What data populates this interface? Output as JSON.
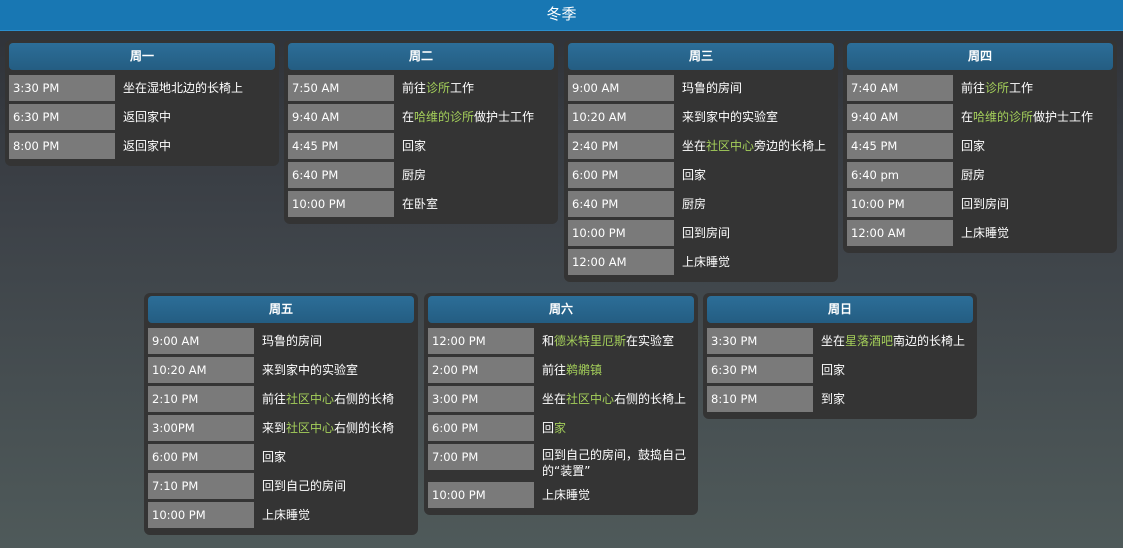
{
  "header": {
    "title": "冬季"
  },
  "days": [
    {
      "title": "周一",
      "entries": [
        {
          "time": "3:30 PM",
          "parts": [
            {
              "text": "坐在湿地北边的长椅上",
              "hl": false
            }
          ]
        },
        {
          "time": "6:30 PM",
          "parts": [
            {
              "text": "返回家中",
              "hl": false
            }
          ]
        },
        {
          "time": "8:00 PM",
          "parts": [
            {
              "text": "返回家中",
              "hl": false
            }
          ]
        }
      ]
    },
    {
      "title": "周二",
      "entries": [
        {
          "time": "7:50 AM",
          "parts": [
            {
              "text": "前往",
              "hl": false
            },
            {
              "text": "诊所",
              "hl": true
            },
            {
              "text": "工作",
              "hl": false
            }
          ]
        },
        {
          "time": "9:40 AM",
          "parts": [
            {
              "text": "在",
              "hl": false
            },
            {
              "text": "哈维的诊所",
              "hl": true
            },
            {
              "text": "做护士工作",
              "hl": false
            }
          ]
        },
        {
          "time": "4:45 PM",
          "parts": [
            {
              "text": "回家",
              "hl": false
            }
          ]
        },
        {
          "time": "6:40 PM",
          "parts": [
            {
              "text": "厨房",
              "hl": false
            }
          ]
        },
        {
          "time": "10:00 PM",
          "parts": [
            {
              "text": "在卧室",
              "hl": false
            }
          ]
        }
      ]
    },
    {
      "title": "周三",
      "entries": [
        {
          "time": "9:00 AM",
          "parts": [
            {
              "text": "玛鲁的房间",
              "hl": false
            }
          ]
        },
        {
          "time": "10:20 AM",
          "parts": [
            {
              "text": "来到家中的实验室",
              "hl": false
            }
          ]
        },
        {
          "time": "2:40 PM",
          "parts": [
            {
              "text": "坐在",
              "hl": false
            },
            {
              "text": "社区中心",
              "hl": true
            },
            {
              "text": "旁边的长椅上",
              "hl": false
            }
          ]
        },
        {
          "time": "6:00 PM",
          "parts": [
            {
              "text": "回家",
              "hl": false
            }
          ]
        },
        {
          "time": "6:40 PM",
          "parts": [
            {
              "text": "厨房",
              "hl": false
            }
          ]
        },
        {
          "time": "10:00 PM",
          "parts": [
            {
              "text": "回到房间",
              "hl": false
            }
          ]
        },
        {
          "time": "12:00 AM",
          "parts": [
            {
              "text": "上床睡觉",
              "hl": false
            }
          ]
        }
      ]
    },
    {
      "title": "周四",
      "entries": [
        {
          "time": "7:40 AM",
          "parts": [
            {
              "text": "前往",
              "hl": false
            },
            {
              "text": "诊所",
              "hl": true
            },
            {
              "text": "工作",
              "hl": false
            }
          ]
        },
        {
          "time": "9:40 AM",
          "parts": [
            {
              "text": "在",
              "hl": false
            },
            {
              "text": "哈维的诊所",
              "hl": true
            },
            {
              "text": "做护士工作",
              "hl": false
            }
          ]
        },
        {
          "time": "4:45 PM",
          "parts": [
            {
              "text": "回家",
              "hl": false
            }
          ]
        },
        {
          "time": "6:40 pm",
          "parts": [
            {
              "text": "厨房",
              "hl": false
            }
          ]
        },
        {
          "time": "10:00 PM",
          "parts": [
            {
              "text": "回到房间",
              "hl": false
            }
          ]
        },
        {
          "time": "12:00 AM",
          "parts": [
            {
              "text": "上床睡觉",
              "hl": false
            }
          ]
        }
      ]
    },
    {
      "title": "周五",
      "entries": [
        {
          "time": "9:00 AM",
          "parts": [
            {
              "text": "玛鲁的房间",
              "hl": false
            }
          ]
        },
        {
          "time": "10:20 AM",
          "parts": [
            {
              "text": "来到家中的实验室",
              "hl": false
            }
          ]
        },
        {
          "time": "2:10 PM",
          "parts": [
            {
              "text": "前往",
              "hl": false
            },
            {
              "text": "社区中心",
              "hl": true
            },
            {
              "text": "右侧的长椅",
              "hl": false
            }
          ]
        },
        {
          "time": "3:00PM",
          "parts": [
            {
              "text": "来到",
              "hl": false
            },
            {
              "text": "社区中心",
              "hl": true
            },
            {
              "text": "右侧的长椅",
              "hl": false
            }
          ]
        },
        {
          "time": "6:00 PM",
          "parts": [
            {
              "text": "回家",
              "hl": false
            }
          ]
        },
        {
          "time": "7:10 PM",
          "parts": [
            {
              "text": "回到自己的房间",
              "hl": false
            }
          ]
        },
        {
          "time": "10:00 PM",
          "parts": [
            {
              "text": "上床睡觉",
              "hl": false
            }
          ]
        }
      ]
    },
    {
      "title": "周六",
      "entries": [
        {
          "time": "12:00 PM",
          "parts": [
            {
              "text": "和",
              "hl": false
            },
            {
              "text": "德米特里厄斯",
              "hl": true
            },
            {
              "text": "在实验室",
              "hl": false
            }
          ]
        },
        {
          "time": "2:00 PM",
          "parts": [
            {
              "text": "前往",
              "hl": false
            },
            {
              "text": "鹈鹕镇",
              "hl": true
            }
          ]
        },
        {
          "time": "3:00 PM",
          "parts": [
            {
              "text": "坐在",
              "hl": false
            },
            {
              "text": "社区中心",
              "hl": true
            },
            {
              "text": "右侧的长椅上",
              "hl": false
            }
          ]
        },
        {
          "time": "6:00 PM",
          "parts": [
            {
              "text": "回",
              "hl": false
            },
            {
              "text": "家",
              "hl": true
            }
          ]
        },
        {
          "time": "7:00 PM",
          "tall": true,
          "parts": [
            {
              "text": "回到自己的房间，鼓捣自己的“装置”",
              "hl": false
            }
          ]
        },
        {
          "time": "10:00 PM",
          "parts": [
            {
              "text": "上床睡觉",
              "hl": false
            }
          ]
        }
      ]
    },
    {
      "title": "周日",
      "entries": [
        {
          "time": "3:30 PM",
          "parts": [
            {
              "text": "坐在",
              "hl": false
            },
            {
              "text": "星落酒吧",
              "hl": true
            },
            {
              "text": "南边的长椅上",
              "hl": false
            }
          ]
        },
        {
          "time": "6:30 PM",
          "parts": [
            {
              "text": "回家",
              "hl": false
            }
          ]
        },
        {
          "time": "8:10 PM",
          "parts": [
            {
              "text": "到家",
              "hl": false
            }
          ]
        }
      ]
    }
  ]
}
